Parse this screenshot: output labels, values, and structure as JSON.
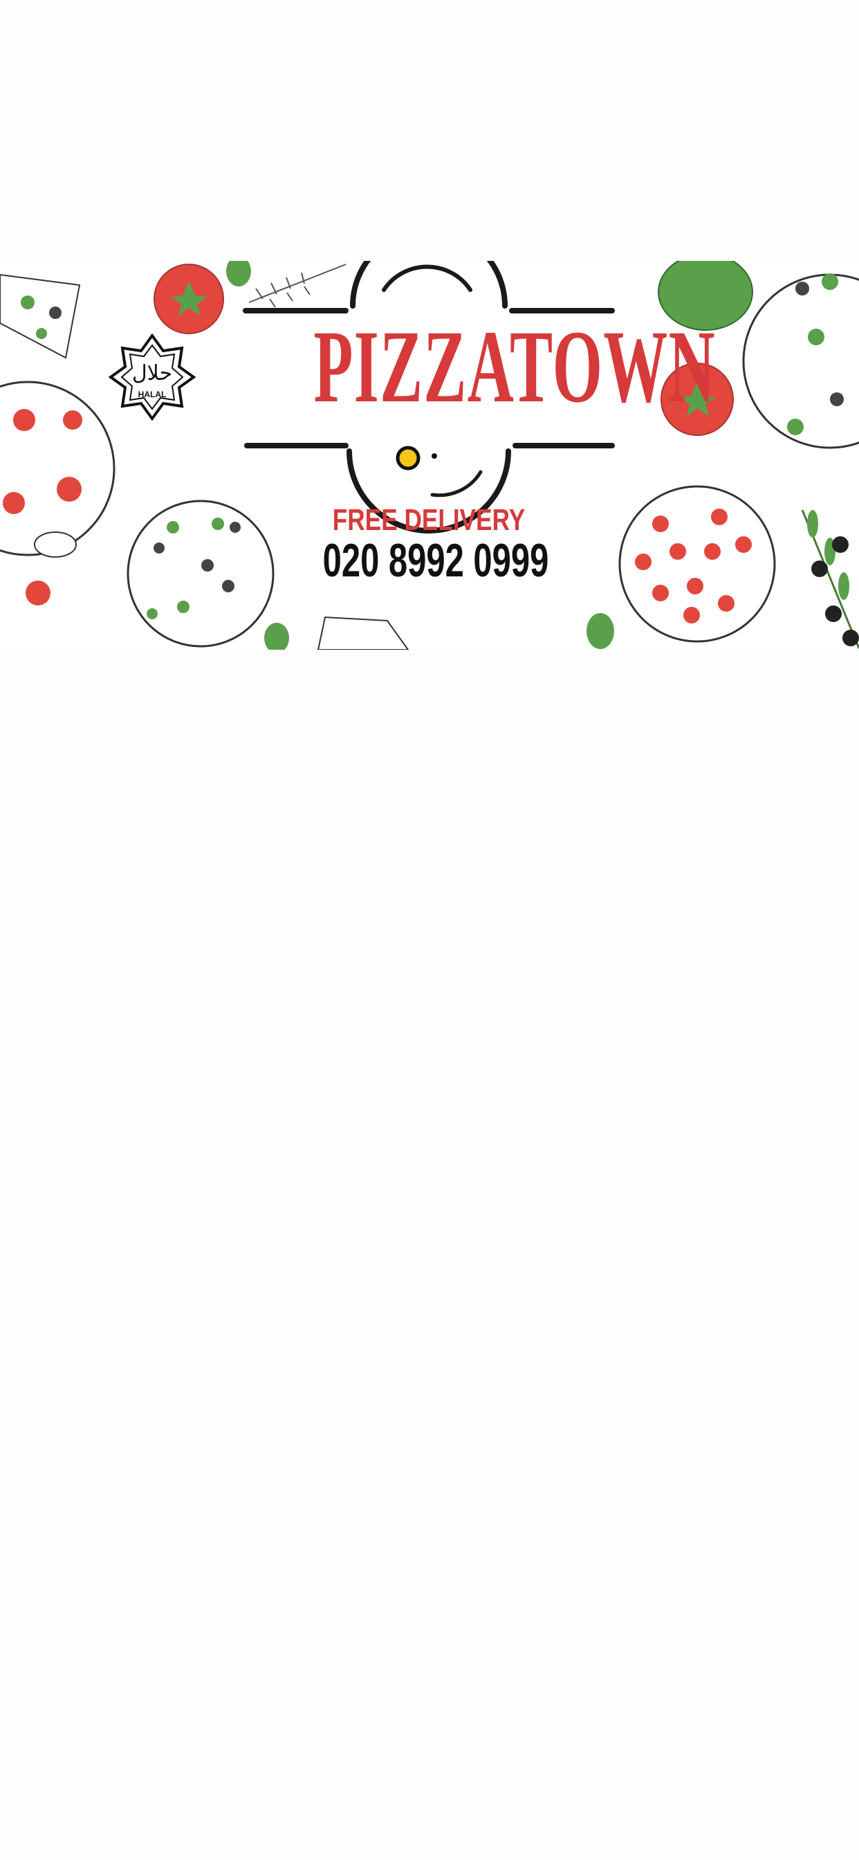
{
  "banner": {
    "brand_name": "PIZZATOWN",
    "tagline": "FREE DELIVERY",
    "phone": "020 8992 0999",
    "halal_badge": {
      "label": "HALAL",
      "arabic": "حلال"
    },
    "colors": {
      "brand_red": "#d63a3a",
      "tomato": "#e2463d",
      "leaf": "#5aa04a",
      "ink": "#111111"
    }
  }
}
